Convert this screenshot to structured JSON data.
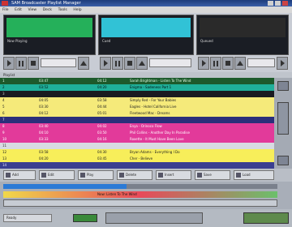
{
  "window": {
    "title": "SAM Broadcaster Playlist Manager"
  },
  "menu": [
    "File",
    "Edit",
    "View",
    "Deck",
    "Tools",
    "Help"
  ],
  "decks": [
    {
      "id": "deck-a",
      "lcd_color": "#25b05a",
      "info": "Now Playing"
    },
    {
      "id": "deck-b",
      "lcd_color": "#31c2d6",
      "info": "Cued"
    },
    {
      "id": "deck-c",
      "lcd_color": "#2a2a2a",
      "info": "Queued"
    }
  ],
  "list_header": "Playlist",
  "playlist": [
    {
      "bg": "#1d5a2c",
      "color": "#e8ffe8",
      "cols": [
        "1",
        "",
        "03:47",
        "",
        "04:12",
        "Sarah Brightman - Listen To The Wind"
      ]
    },
    {
      "bg": "#1fb09a",
      "color": "#001010",
      "cols": [
        "2",
        "",
        "03:52",
        "",
        "04:20",
        "Enigma - Sadeness Part 1"
      ]
    },
    {
      "bg": "#1a1a20",
      "color": "#c8c8c8",
      "cols": [
        "3",
        "",
        "",
        "",
        "",
        ""
      ]
    },
    {
      "bg": "#f5ea7a",
      "color": "#222",
      "cols": [
        "4",
        "",
        "04:05",
        "",
        "03:58",
        "Simply Red - For Your Babies"
      ]
    },
    {
      "bg": "#f5ea7a",
      "color": "#222",
      "cols": [
        "5",
        "",
        "03:30",
        "",
        "04:44",
        "Eagles - Hotel California Live"
      ]
    },
    {
      "bg": "#f5ea7a",
      "color": "#222",
      "cols": [
        "6",
        "",
        "04:12",
        "",
        "05:01",
        "Fleetwood Mac - Dreams"
      ]
    },
    {
      "bg": "#2b2f7a",
      "color": "#e8e8ff",
      "cols": [
        "7",
        "",
        "",
        "",
        "",
        ""
      ]
    },
    {
      "bg": "#e23a9a",
      "color": "#fff",
      "cols": [
        "8",
        "",
        "03:40",
        "",
        "04:02",
        "Enya - Orinoco Flow"
      ]
    },
    {
      "bg": "#e23a9a",
      "color": "#fff",
      "cols": [
        "9",
        "",
        "04:10",
        "",
        "03:50",
        "Phil Collins - Another Day In Paradise"
      ]
    },
    {
      "bg": "#e23a9a",
      "color": "#fff",
      "cols": [
        "10",
        "",
        "03:33",
        "",
        "04:16",
        "Roxette - It Must Have Been Love"
      ]
    },
    {
      "bg": "#d8dbe2",
      "color": "#333",
      "cols": [
        "11",
        "",
        "",
        "",
        "",
        ""
      ]
    },
    {
      "bg": "#f7ee5a",
      "color": "#222",
      "cols": [
        "12",
        "",
        "03:58",
        "",
        "04:30",
        "Bryan Adams - Everything I Do"
      ]
    },
    {
      "bg": "#f7ee5a",
      "color": "#222",
      "cols": [
        "13",
        "",
        "04:20",
        "",
        "03:45",
        "Cher - Believe"
      ]
    },
    {
      "bg": "#3a3f90",
      "color": "#e8e8ff",
      "cols": [
        "14",
        "",
        "",
        "",
        "",
        ""
      ]
    }
  ],
  "actions": [
    {
      "label": "Add"
    },
    {
      "label": "Edit"
    },
    {
      "label": "Play"
    },
    {
      "label": "Delete"
    },
    {
      "label": "Insert"
    },
    {
      "label": "Save"
    },
    {
      "label": "Load"
    }
  ],
  "status": {
    "now": "Now: Listen To The Wind",
    "progress": 0.45
  },
  "footer": {
    "label": "Ready"
  }
}
